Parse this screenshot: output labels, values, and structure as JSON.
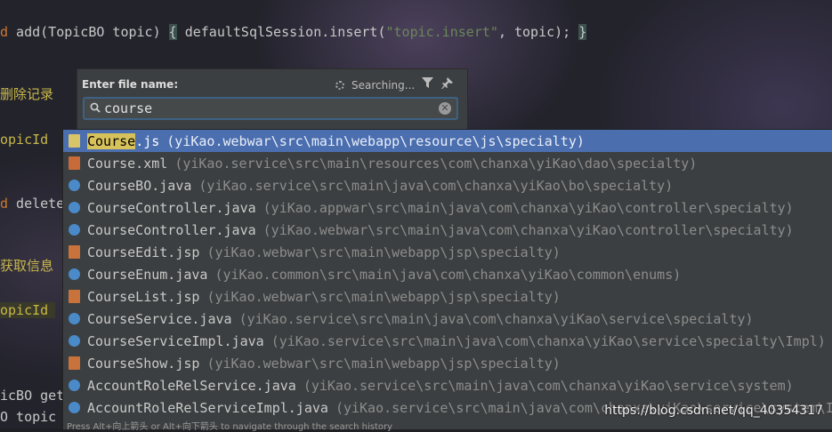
{
  "editor": {
    "line1_kw": "d",
    "line1_code": " add(TopicBO topic) ",
    "line1_brace_open": "{",
    "line1_call": " defaultSqlSession.insert(",
    "line1_string": "\"topic.insert\"",
    "line1_rest": ", topic); ",
    "line1_brace_close": "}",
    "comment1": "删除记录",
    "frag_topicId1": "opicId",
    "line_delete_kw": "d",
    "line_delete": " delete",
    "comment2": "获取信息",
    "frag_topicId2": "opicId",
    "frag_topicBO": "icBO get",
    "frag_topic": "O topic"
  },
  "dialog": {
    "title": "Enter file name:",
    "status": "Searching...",
    "search_value": "course",
    "filter_icon": "filter-icon",
    "pin_icon": "pin-icon"
  },
  "results": [
    {
      "match": "Course",
      "rest": ".js",
      "path": "(yiKao.webwar\\src\\main\\webapp\\resource\\js\\specialty)",
      "type": "js",
      "selected": true
    },
    {
      "match": "",
      "rest": "Course.xml",
      "path": "(yiKao.service\\src\\main\\resources\\com\\chanxa\\yiKao\\dao\\specialty)",
      "type": "xml"
    },
    {
      "match": "",
      "rest": "CourseBO.java",
      "path": "(yiKao.service\\src\\main\\java\\com\\chanxa\\yiKao\\bo\\specialty)",
      "type": "java"
    },
    {
      "match": "",
      "rest": "CourseController.java",
      "path": "(yiKao.appwar\\src\\main\\java\\com\\chanxa\\yiKao\\controller\\specialty)",
      "type": "java"
    },
    {
      "match": "",
      "rest": "CourseController.java",
      "path": "(yiKao.webwar\\src\\main\\java\\com\\chanxa\\yiKao\\controller\\specialty)",
      "type": "java"
    },
    {
      "match": "",
      "rest": "CourseEdit.jsp",
      "path": "(yiKao.webwar\\src\\main\\webapp\\jsp\\specialty)",
      "type": "jsp"
    },
    {
      "match": "",
      "rest": "CourseEnum.java",
      "path": "(yiKao.common\\src\\main\\java\\com\\chanxa\\yiKao\\common\\enums)",
      "type": "java"
    },
    {
      "match": "",
      "rest": "CourseList.jsp",
      "path": "(yiKao.webwar\\src\\main\\webapp\\jsp\\specialty)",
      "type": "jsp"
    },
    {
      "match": "",
      "rest": "CourseService.java",
      "path": "(yiKao.service\\src\\main\\java\\com\\chanxa\\yiKao\\service\\specialty)",
      "type": "java"
    },
    {
      "match": "",
      "rest": "CourseServiceImpl.java",
      "path": "(yiKao.service\\src\\main\\java\\com\\chanxa\\yiKao\\service\\specialty\\Impl)",
      "type": "java"
    },
    {
      "match": "",
      "rest": "CourseShow.jsp",
      "path": "(yiKao.webwar\\src\\main\\webapp\\jsp\\specialty)",
      "type": "jsp"
    },
    {
      "match": "",
      "rest": "AccountRoleRelService.java",
      "path": "(yiKao.service\\src\\main\\java\\com\\chanxa\\yiKao\\service\\system)",
      "type": "java"
    },
    {
      "match": "",
      "rest": "AccountRoleRelServiceImpl.java",
      "path": "(yiKao.service\\src\\main\\java\\com\\chanxa\\yiKao\\service\\system\\Impl)",
      "type": "java"
    }
  ],
  "hint": "Press Alt+向上箭头 or Alt+向下箭头 to navigate through the search history",
  "watermark": "https://blog.csdn.net/qq_40354317"
}
